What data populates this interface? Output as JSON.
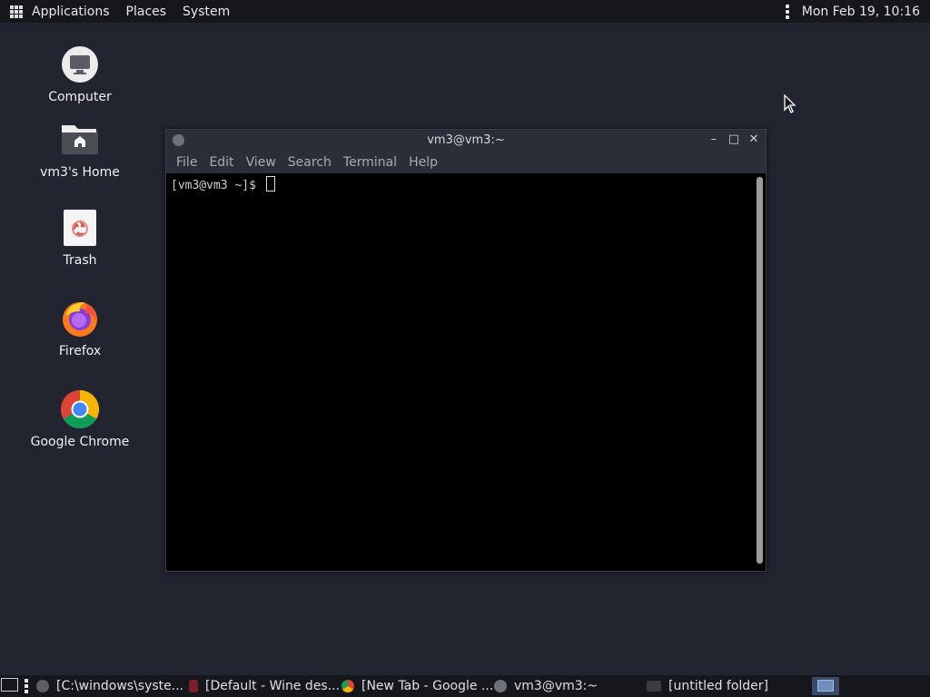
{
  "top_panel": {
    "applications": "Applications",
    "places": "Places",
    "system": "System",
    "clock": "Mon Feb 19, 10:16"
  },
  "desktop": {
    "icons": [
      {
        "label": "Computer",
        "icon": "computer-icon"
      },
      {
        "label": "vm3's Home",
        "icon": "home-folder-icon"
      },
      {
        "label": "Trash",
        "icon": "trash-icon"
      },
      {
        "label": "Firefox",
        "icon": "firefox-icon"
      },
      {
        "label": "Google Chrome",
        "icon": "chrome-icon"
      }
    ]
  },
  "terminal": {
    "title": "vm3@vm3:~",
    "menu": [
      "File",
      "Edit",
      "View",
      "Search",
      "Terminal",
      "Help"
    ],
    "prompt": "[vm3@vm3 ~]$ "
  },
  "taskbar": {
    "tasks": [
      {
        "label": "[C:\\windows\\syste...",
        "icon": "wine-console-icon"
      },
      {
        "label": "[Default - Wine des...",
        "icon": "wine-icon"
      },
      {
        "label": "[New Tab - Google ...",
        "icon": "chrome-icon"
      },
      {
        "label": "vm3@vm3:~",
        "icon": "terminal-icon"
      },
      {
        "label": "[untitled folder]",
        "icon": "folder-icon"
      }
    ]
  },
  "colors": {
    "desktop_bg": "#222430",
    "panel_bg": "#16171d",
    "terminal_bg": "#000000"
  }
}
